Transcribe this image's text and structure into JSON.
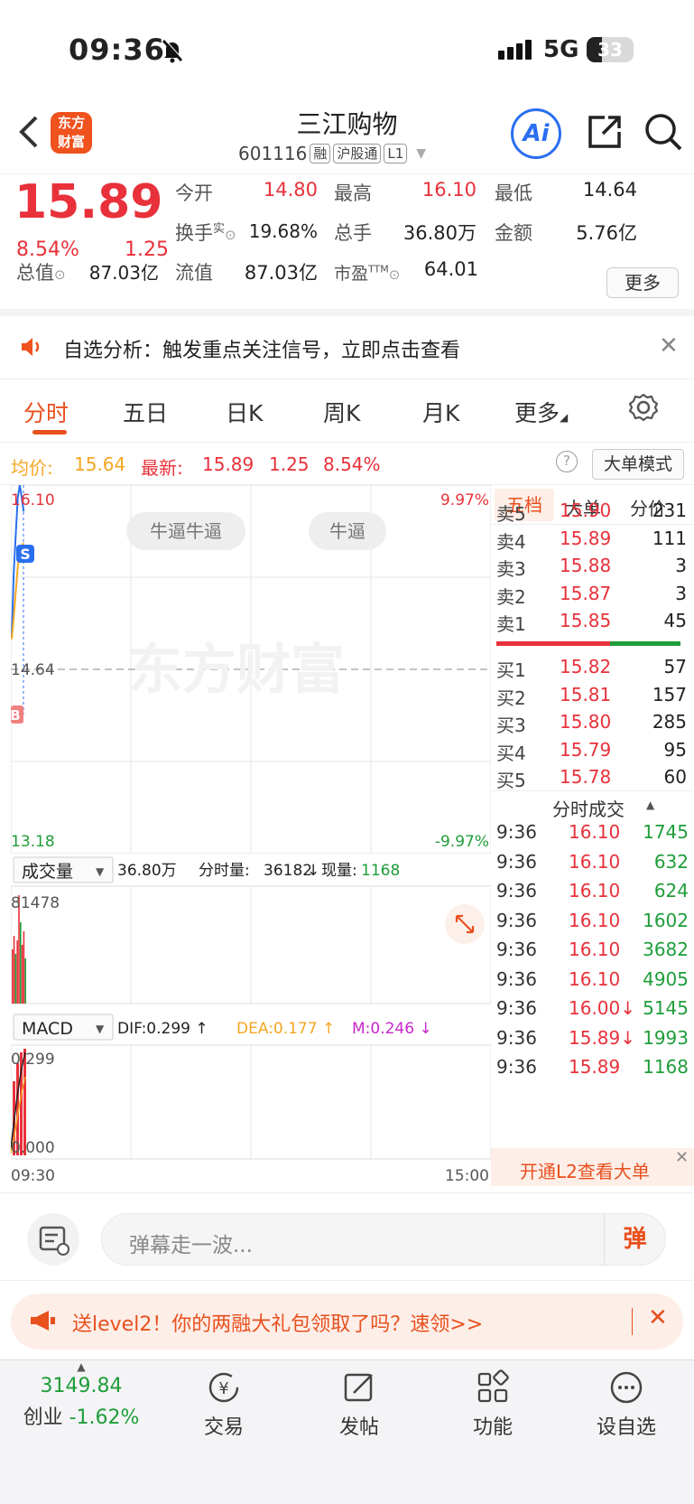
{
  "status_bar": {
    "time": "09:36",
    "network": "5G",
    "battery": "33",
    "battery_level": 0.33
  },
  "header": {
    "logo_text": "东方财富",
    "stock_name": "三江购物",
    "stock_code": "601116",
    "tags": [
      "融",
      "沪股通",
      "L1"
    ],
    "ai_label": "Ai"
  },
  "quote": {
    "price": "15.89",
    "change_pct": "8.54%",
    "change": "1.25",
    "open_label": "今开",
    "open": "14.80",
    "high_label": "最高",
    "high": "16.10",
    "low_label": "最低",
    "low": "14.64",
    "turnover_label": "换手",
    "turnover_sup": "实",
    "turnover": "19.68%",
    "volume_label": "总手",
    "volume": "36.80万",
    "amount_label": "金额",
    "amount": "5.76亿",
    "mktcap_label": "总值",
    "mktcap": "87.03亿",
    "float_label": "流值",
    "float": "87.03亿",
    "pe_label": "市盈",
    "pe_sup": "TTM",
    "pe": "64.01",
    "more_button": "更多"
  },
  "notice": {
    "text": "自选分析：触发重点关注信号，立即点击查看"
  },
  "tabs": [
    "分时",
    "五日",
    "日K",
    "周K",
    "月K",
    "更多"
  ],
  "active_tab": 0,
  "infobar": {
    "avg_label": "均价:",
    "avg": "15.64",
    "latest_label": "最新:",
    "latest": "15.89",
    "change": "1.25",
    "pct": "8.54%",
    "mode_button": "大单模式"
  },
  "chart": {
    "y_top": "16.10",
    "y_mid": "14.64",
    "y_bottom": "13.18",
    "pct_top": "9.97%",
    "pct_bottom": "-9.97%",
    "watermark": "东方财富",
    "danmaku": [
      "牛逼牛逼",
      "牛逼"
    ],
    "marker_s": "S",
    "marker_b": "B",
    "volume_selector": "成交量",
    "volume_total": "36.80万",
    "volume_detail_label": "分时量:",
    "volume_detail": "36182",
    "volume_now_label": "现量:",
    "volume_now": "1168",
    "volume_max": "81478",
    "macd_selector": "MACD",
    "dif": "DIF:0.299 ↑",
    "dea": "DEA:0.177 ↑",
    "m": "M:0.246 ↓",
    "macd_top": "0.299",
    "macd_bottom": "0.000",
    "time_start": "09:30",
    "time_end": "15:00"
  },
  "chart_data": {
    "type": "line",
    "title": "",
    "x": [
      "09:30",
      "09:31",
      "09:32",
      "09:33",
      "09:34",
      "09:35",
      "09:36"
    ],
    "series": [
      {
        "values": [
          14.9,
          15.4,
          15.7,
          16.0,
          16.1,
          16.0,
          15.89
        ]
      },
      {
        "values": [
          14.88,
          15.05,
          15.25,
          15.45,
          15.58,
          15.62,
          15.64
        ]
      }
    ],
    "ylim": [
      13.18,
      16.1
    ],
    "xlim": [
      "09:30",
      "15:00"
    ],
    "prev_close": 14.64,
    "grid": true
  },
  "side_panel": {
    "tabs": [
      "五档",
      "大单",
      "分价"
    ],
    "asks": [
      {
        "label": "卖5",
        "price": "15.90",
        "vol": "231"
      },
      {
        "label": "卖4",
        "price": "15.89",
        "vol": "111"
      },
      {
        "label": "卖3",
        "price": "15.88",
        "vol": "3"
      },
      {
        "label": "卖2",
        "price": "15.87",
        "vol": "3"
      },
      {
        "label": "卖1",
        "price": "15.85",
        "vol": "45"
      }
    ],
    "bids": [
      {
        "label": "买1",
        "price": "15.82",
        "vol": "57"
      },
      {
        "label": "买2",
        "price": "15.81",
        "vol": "157"
      },
      {
        "label": "买3",
        "price": "15.80",
        "vol": "285"
      },
      {
        "label": "买4",
        "price": "15.79",
        "vol": "95"
      },
      {
        "label": "买5",
        "price": "15.78",
        "vol": "60"
      }
    ],
    "ticks_title": "分时成交",
    "ticks": [
      {
        "time": "9:36",
        "price": "16.10",
        "vol": "1745",
        "dir": "up"
      },
      {
        "time": "9:36",
        "price": "16.10",
        "vol": "632",
        "dir": "up"
      },
      {
        "time": "9:36",
        "price": "16.10",
        "vol": "624",
        "dir": "up"
      },
      {
        "time": "9:36",
        "price": "16.10",
        "vol": "1602",
        "dir": "up"
      },
      {
        "time": "9:36",
        "price": "16.10",
        "vol": "3682",
        "dir": "up"
      },
      {
        "time": "9:36",
        "price": "16.10",
        "vol": "4905",
        "dir": "up"
      },
      {
        "time": "9:36",
        "price": "16.00↓",
        "vol": "5145",
        "dir": "down"
      },
      {
        "time": "9:36",
        "price": "15.89↓",
        "vol": "1993",
        "dir": "down"
      },
      {
        "time": "9:36",
        "price": "15.89",
        "vol": "1168",
        "dir": "up"
      }
    ],
    "l2_banner": "开通L2查看大单"
  },
  "comment": {
    "placeholder": "弹幕走一波...",
    "danmaku_btn": "弹"
  },
  "promo": {
    "text": "送level2！你的两融大礼包领取了吗？速领>>"
  },
  "bottom_nav": {
    "index_value": "3149.84",
    "index_name": "创业",
    "index_change": "-1.62%",
    "items": [
      "交易",
      "发帖",
      "功能",
      "设自选"
    ]
  },
  "colors": {
    "up": "#e8313a",
    "down": "#1f9d3a",
    "accent": "#e8501e",
    "avg_line": "#f5a623",
    "price_line": "#2a6ff0"
  }
}
